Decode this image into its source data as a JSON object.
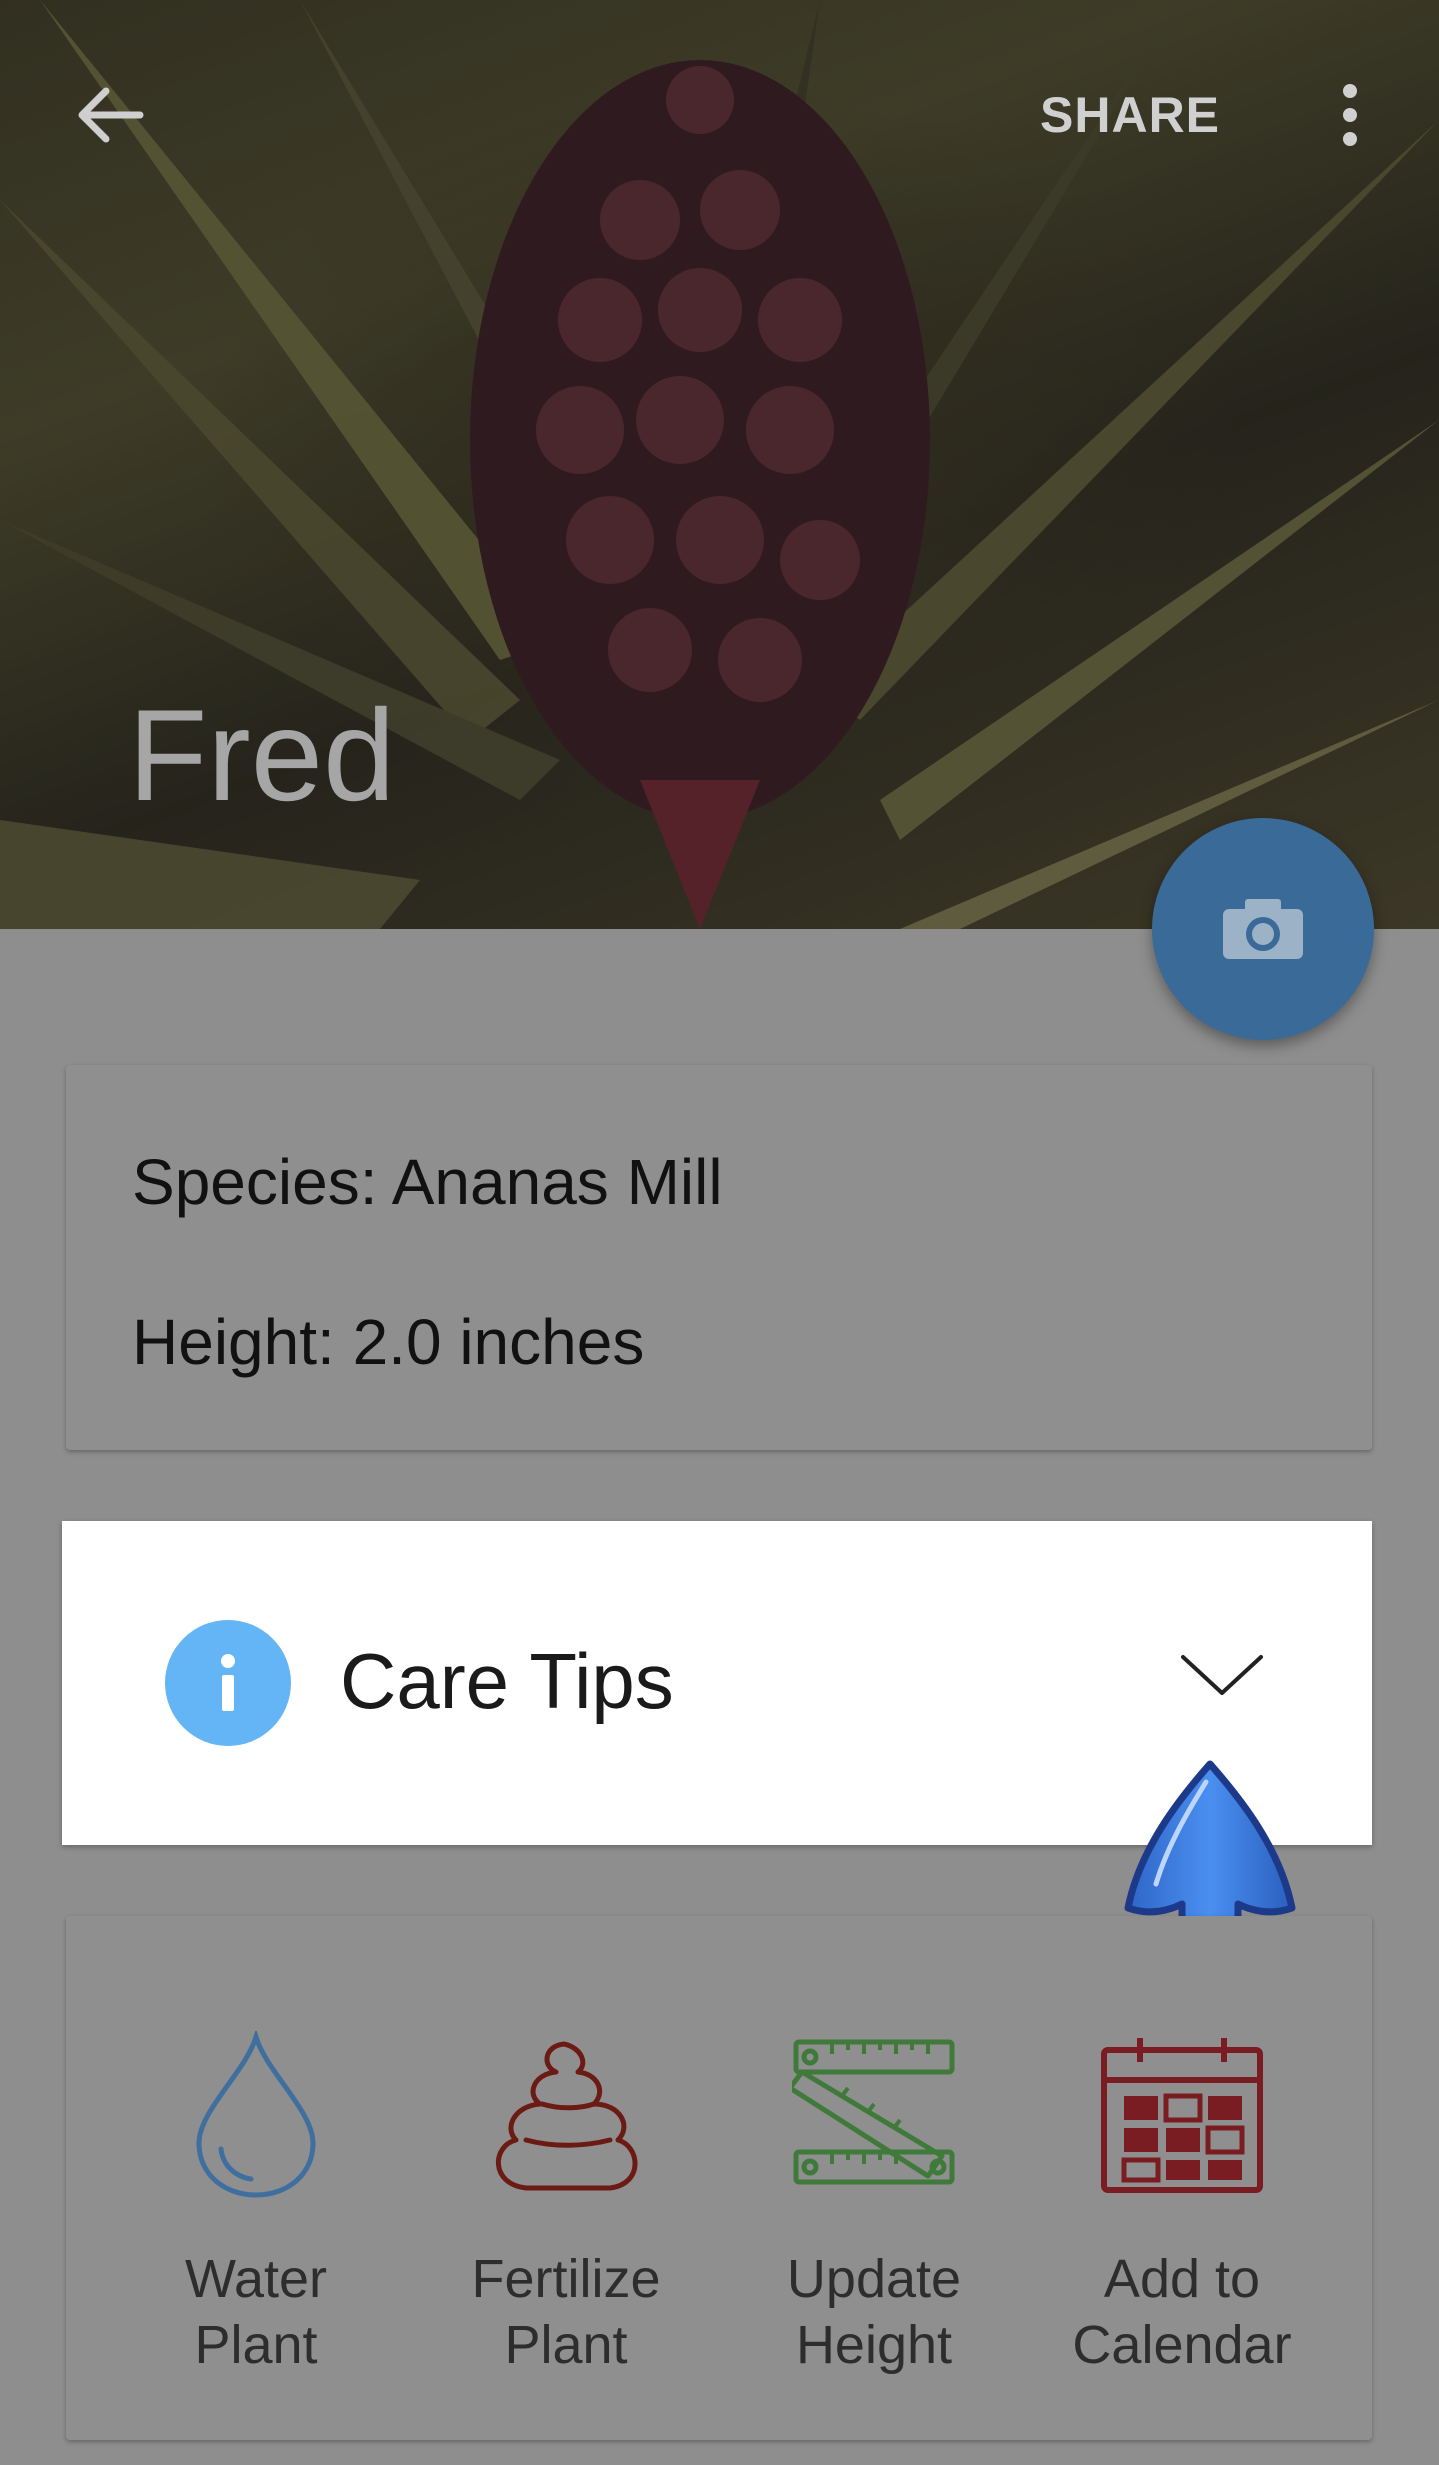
{
  "toolbar": {
    "back_icon": "arrow-back-icon",
    "share_label": "SHARE",
    "menu_icon": "more-vert-icon"
  },
  "plant": {
    "name": "Fred",
    "species_text": "Species: Ananas Mill",
    "height_text": "Height: 2.0 inches"
  },
  "fab": {
    "icon": "camera-icon",
    "color": "#3a6a97"
  },
  "care_tips": {
    "title": "Care Tips",
    "icon": "info-icon",
    "icon_color": "#64b5f6",
    "toggle_icon": "chevron-down-icon"
  },
  "pointer": {
    "icon": "arrow-up-icon",
    "color": "#3b7bd8"
  },
  "actions": [
    {
      "label": "Water\nPlant",
      "icon": "water-drop-icon",
      "color": "#3f6f9e"
    },
    {
      "label": "Fertilize\nPlant",
      "icon": "fertilizer-icon",
      "color": "#6b1b14"
    },
    {
      "label": "Update\nHeight",
      "icon": "ruler-icon",
      "color": "#3f7a3a"
    },
    {
      "label": "Add to\nCalendar",
      "icon": "calendar-icon",
      "color": "#7a1d22"
    }
  ]
}
